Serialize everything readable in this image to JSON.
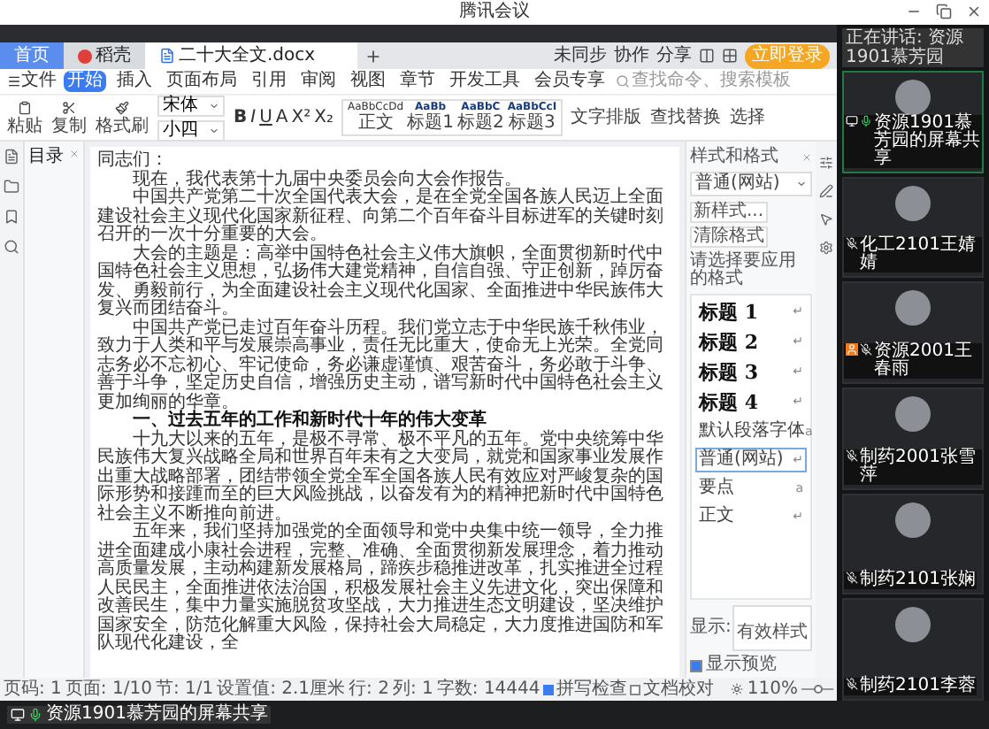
{
  "window": {
    "title": "腾讯会议"
  },
  "tabs": [
    {
      "label": "首页",
      "kind": "home",
      "selected": false
    },
    {
      "label": "稻壳",
      "kind": "app",
      "selected": false
    },
    {
      "label": "二十大全文.docx",
      "kind": "doc",
      "selected": true
    }
  ],
  "login_button": "立即登录",
  "menu": {
    "file": "文件",
    "items": [
      {
        "label": "开始",
        "selected": true
      },
      {
        "label": "插入",
        "selected": false
      },
      {
        "label": "页面布局",
        "selected": false
      },
      {
        "label": "引用",
        "selected": false
      },
      {
        "label": "审阅",
        "selected": false
      },
      {
        "label": "视图",
        "selected": false
      },
      {
        "label": "章节",
        "selected": false
      },
      {
        "label": "开发工具",
        "selected": false
      },
      {
        "label": "会员专享",
        "selected": false
      }
    ],
    "search_placeholder": "查找命令、搜索模板",
    "actions": [
      "未同步",
      "协作",
      "分享"
    ]
  },
  "ribbon": {
    "clipboard": [
      "粘贴",
      "复制",
      "格式刷"
    ],
    "font": "宋体",
    "size": "小四",
    "format_buttons": [
      "B",
      "I",
      "U",
      "A",
      "X²",
      "X₂"
    ],
    "gallery": [
      {
        "sample": "AaBbCcDd",
        "label": "正文"
      },
      {
        "sample": "AaBb",
        "label": "标题1"
      },
      {
        "sample": "AaBbC",
        "label": "标题2"
      },
      {
        "sample": "AaBbCcI",
        "label": "标题3"
      }
    ],
    "tools": [
      "文字排版",
      "查找替换",
      "选择"
    ]
  },
  "outline": {
    "title": "目录"
  },
  "document": {
    "paragraphs": [
      {
        "kind": "salutation",
        "text": "同志们："
      },
      {
        "kind": "body",
        "text": "现在，我代表第十九届中央委员会向大会作报告。"
      },
      {
        "kind": "body",
        "text": "中国共产党第二十次全国代表大会，是在全党全国各族人民迈上全面建设社会主义现代化国家新征程、向第二个百年奋斗目标进军的关键时刻召开的一次十分重要的大会。"
      },
      {
        "kind": "body",
        "text": "大会的主题是：高举中国特色社会主义伟大旗帜，全面贯彻新时代中国特色社会主义思想，弘扬伟大建党精神，自信自强、守正创新，踔厉奋发、勇毅前行，为全面建设社会主义现代化国家、全面推进中华民族伟大复兴而团结奋斗。"
      },
      {
        "kind": "body",
        "text": "中国共产党已走过百年奋斗历程。我们党立志于中华民族千秋伟业，致力于人类和平与发展崇高事业，责任无比重大，使命无上光荣。全党同志务必不忘初心、牢记使命，务必谦虚谨慎、艰苦奋斗，务必敢于斗争、善于斗争，坚定历史自信，增强历史主动，谱写新时代中国特色社会主义更加绚丽的华章。"
      },
      {
        "kind": "heading",
        "text": "一、过去五年的工作和新时代十年的伟大变革"
      },
      {
        "kind": "body",
        "text": "十九大以来的五年，是极不寻常、极不平凡的五年。党中央统筹中华民族伟大复兴战略全局和世界百年未有之大变局，就党和国家事业发展作出重大战略部署，团结带领全党全军全国各族人民有效应对严峻复杂的国际形势和接踵而至的巨大风险挑战，以奋发有为的精神把新时代中国特色社会主义不断推向前进。"
      },
      {
        "kind": "body",
        "text": "五年来，我们坚持加强党的全面领导和党中央集中统一领导，全力推进全面建成小康社会进程，完整、准确、全面贯彻新发展理念，着力推动高质量发展，主动构建新发展格局，蹄疾步稳推进改革，扎实推进全过程人民民主，全面推进依法治国，积极发展社会主义先进文化，突出保障和改善民生，集中力量实施脱贫攻坚战，大力推进生态文明建设，坚决维护国家安全，防范化解重大风险，保持社会大局稳定，大力度推进国防和军队现代化建设，全"
      }
    ]
  },
  "styles_panel": {
    "title": "样式和格式",
    "current": "普通(网站)",
    "buttons": [
      "新样式...",
      "清除格式"
    ],
    "prompt": "请选择要应用的格式",
    "styles": [
      {
        "label": "标题 1",
        "kind": "heading",
        "mark": "↵",
        "selected": false
      },
      {
        "label": "标题 2",
        "kind": "heading",
        "mark": "↵",
        "selected": false
      },
      {
        "label": "标题 3",
        "kind": "heading",
        "mark": "↵",
        "selected": false
      },
      {
        "label": "标题 4",
        "kind": "heading",
        "mark": "↵",
        "selected": false
      },
      {
        "label": "默认段落字体",
        "kind": "plain",
        "mark": "a",
        "selected": false
      },
      {
        "label": "普通(网站)",
        "kind": "plain",
        "mark": "↵",
        "selected": true
      },
      {
        "label": "要点",
        "kind": "plain",
        "mark": "a",
        "selected": false
      },
      {
        "label": "正文",
        "kind": "plain",
        "mark": "↵",
        "selected": false
      }
    ],
    "show_label": "显示:",
    "show_value": "有效样式",
    "preview": {
      "label": "显示预览",
      "checked": true
    }
  },
  "status_bar": {
    "fields": [
      "页码: 1",
      "页面: 1/10",
      "节: 1/1",
      "设置值: 2.1厘米",
      "行: 2",
      "列: 1",
      "字数: 14444"
    ],
    "checks": [
      {
        "label": "拼写检查",
        "checked": true
      },
      {
        "label": "文档校对",
        "checked": false
      }
    ],
    "zoom": "110%",
    "level": 0.5
  },
  "speaking": "正在讲话: 资源1901慕芳园",
  "participants": [
    {
      "name": "资源1901慕芳园的屏幕共享",
      "muted": false,
      "active": true,
      "host": false,
      "sharing": true
    },
    {
      "name": "化工2101王婧婧",
      "muted": true,
      "active": false,
      "host": false,
      "sharing": false
    },
    {
      "name": "资源2001王春雨",
      "muted": true,
      "active": false,
      "host": true,
      "sharing": false
    },
    {
      "name": "制药2001张雪萍",
      "muted": true,
      "active": false,
      "host": false,
      "sharing": false
    },
    {
      "name": "制药2101张娴",
      "muted": true,
      "active": false,
      "host": false,
      "sharing": false
    },
    {
      "name": "制药2101李蓉",
      "muted": true,
      "active": false,
      "host": false,
      "sharing": false
    }
  ],
  "share_label": "资源1901慕芳园的屏幕共享"
}
